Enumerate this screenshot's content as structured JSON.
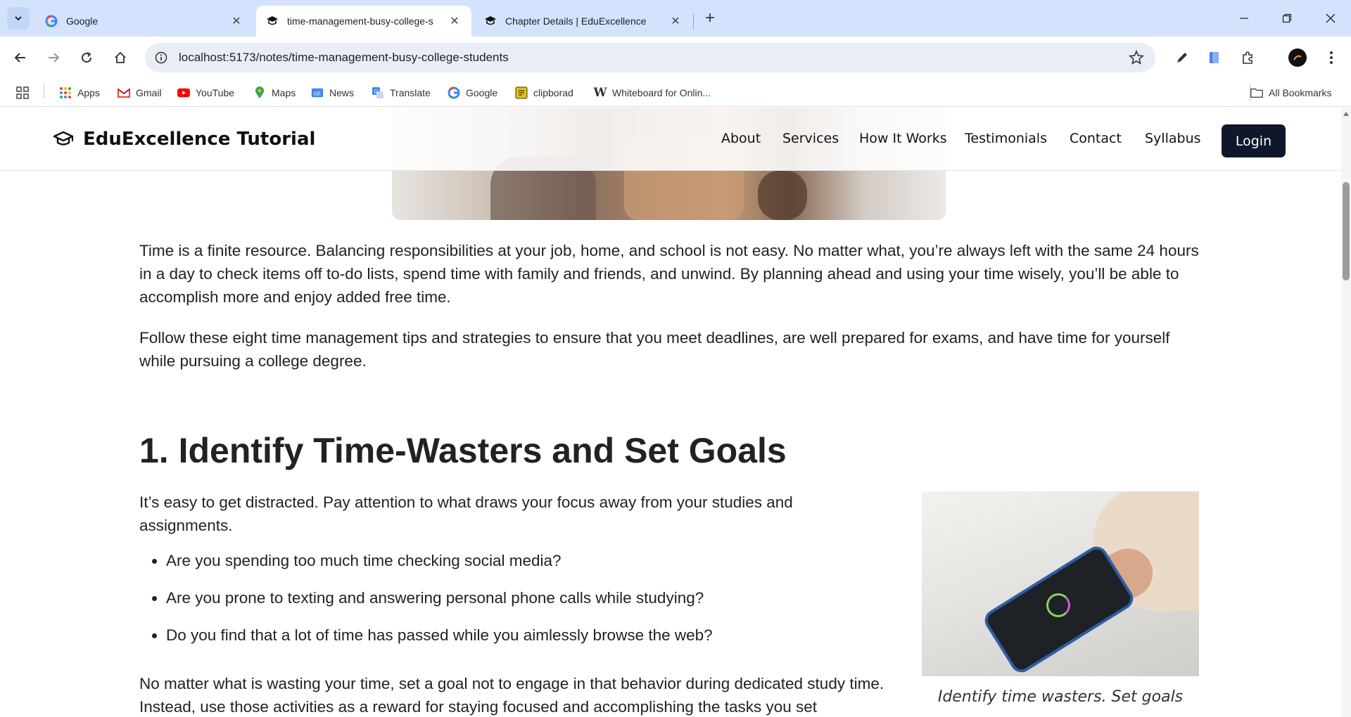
{
  "browser": {
    "tabs": [
      {
        "title": "Google",
        "icon": "google-icon",
        "active": false
      },
      {
        "title": "time-management-busy-college-s",
        "icon": "graduation-cap-icon",
        "active": true
      },
      {
        "title": "Chapter Details | EduExcellence",
        "icon": "graduation-cap-icon",
        "active": false
      }
    ],
    "url": "localhost:5173/notes/time-management-busy-college-students",
    "bookmarks": [
      {
        "label": "Apps",
        "icon": "apps-grid-icon"
      },
      {
        "label": "Gmail",
        "icon": "gmail-icon"
      },
      {
        "label": "YouTube",
        "icon": "youtube-icon"
      },
      {
        "label": "Maps",
        "icon": "maps-pin-icon"
      },
      {
        "label": "News",
        "icon": "news-icon"
      },
      {
        "label": "Translate",
        "icon": "translate-icon"
      },
      {
        "label": "Google",
        "icon": "google-icon"
      },
      {
        "label": "clipborad",
        "icon": "clipboard-icon"
      },
      {
        "label": "Whiteboard for Onlin...",
        "icon": "whiteboard-w-icon"
      }
    ],
    "all_bookmarks": "All Bookmarks"
  },
  "site": {
    "brand": "EduExcellence Tutorial",
    "nav": [
      "About",
      "Services",
      "How It Works",
      "Testimonials",
      "Contact",
      "Syllabus"
    ],
    "login": "Login"
  },
  "article": {
    "intro_p1": "Time is a finite resource. Balancing responsibilities at your job, home, and school is not easy. No matter what, you’re always left with the same 24 hours in a day to check items off to-do lists, spend time with family and friends, and unwind. By planning ahead and using your time wisely, you’ll be able to accomplish more and enjoy added free time.",
    "intro_p2": "Follow these eight time management tips and strategies to ensure that you meet deadlines, are well prepared for exams, and have time for yourself while pursuing a college degree.",
    "section1_heading": "1. Identify Time-Wasters and Set Goals",
    "section1_lead": "It’s easy to get distracted. Pay attention to what draws your focus away from your studies and assignments.",
    "section1_bullets": [
      "Are you spending too much time checking social media?",
      "Are you prone to texting and answering personal phone calls while studying?",
      "Do you find that a lot of time has passed while you aimlessly browse the web?"
    ],
    "section1_after": "No matter what is wasting your time, set a goal not to engage in that behavior during dedicated study time. Instead, use those activities as a reward for staying focused and accomplishing the tasks you set",
    "image_caption": "Identify time wasters. Set goals"
  }
}
